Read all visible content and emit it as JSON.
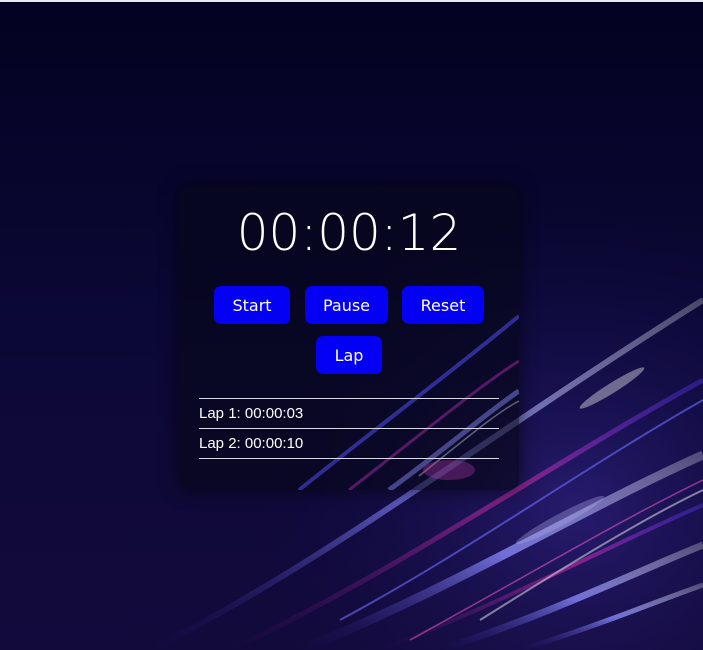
{
  "stopwatch": {
    "time": "00:00:12",
    "buttons": {
      "start": "Start",
      "pause": "Pause",
      "reset": "Reset",
      "lap": "Lap"
    },
    "laps": [
      "Lap 1: 00:00:03",
      "Lap 2: 00:00:10"
    ]
  },
  "colors": {
    "background": "#07052a",
    "button": "#0400f4",
    "text": "#ffffff"
  }
}
